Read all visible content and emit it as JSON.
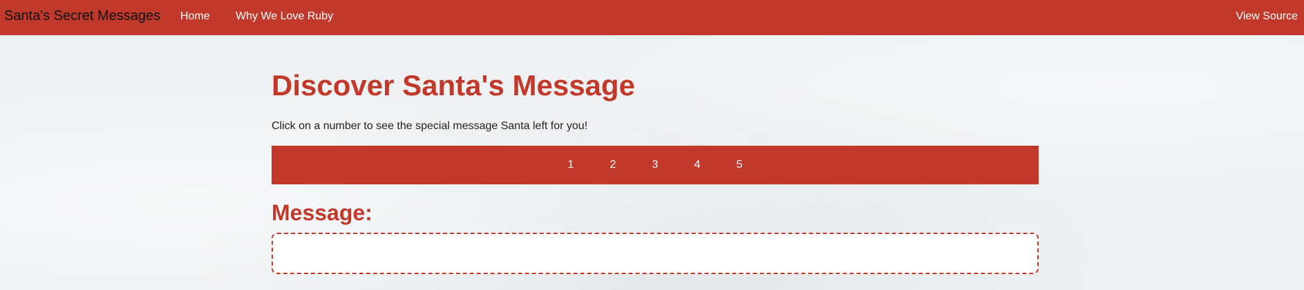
{
  "navbar": {
    "brand": "Santa's Secret Messages",
    "links": {
      "home": "Home",
      "ruby": "Why We Love Ruby",
      "source": "View Source"
    },
    "color": "#c0392b"
  },
  "main": {
    "title": "Discover Santa's Message",
    "intro": "Click on a number to see the special message Santa left for you!",
    "numbers": [
      "1",
      "2",
      "3",
      "4",
      "5"
    ],
    "message_heading": "Message:",
    "message_text": ""
  },
  "colors": {
    "accent": "#c0392b",
    "background": "#eef0f2",
    "text": "#222222"
  }
}
